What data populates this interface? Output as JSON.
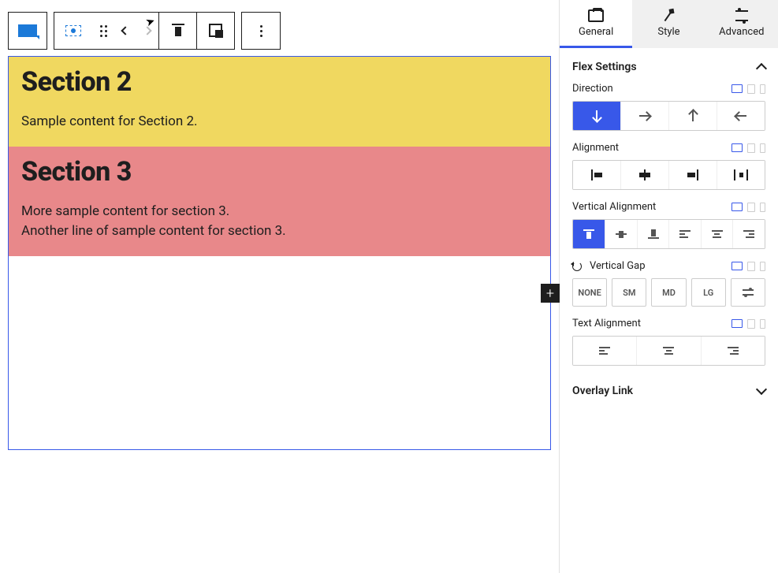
{
  "toolbar": {
    "block_type": "stack-block",
    "select_parent": "select-parent",
    "drag": "drag-handle",
    "move_prev": "move-left",
    "move_next": "move-right",
    "align": "align-top",
    "overlap": "overlap-toggle",
    "more": "more-options"
  },
  "content": {
    "sections": [
      {
        "heading": "Section 2",
        "paragraphs": [
          "Sample content for Section 2."
        ],
        "bg": "yellow"
      },
      {
        "heading": "Section 3",
        "paragraphs": [
          "More sample content for section 3.",
          "Another line of sample content for section 3."
        ],
        "bg": "pink"
      }
    ],
    "add_label": "+"
  },
  "sidebar": {
    "tabs": [
      {
        "label": "General",
        "active": true
      },
      {
        "label": "Style",
        "active": false
      },
      {
        "label": "Advanced",
        "active": false
      }
    ],
    "panels": {
      "flex": {
        "title": "Flex Settings",
        "controls": {
          "direction": {
            "label": "Direction",
            "options": [
              "down",
              "right",
              "up",
              "left"
            ],
            "active": 0
          },
          "alignment": {
            "label": "Alignment",
            "options": [
              "start",
              "center",
              "end",
              "space-between"
            ],
            "active": null
          },
          "vertical_alignment": {
            "label": "Vertical Alignment",
            "options": [
              "top",
              "middle",
              "bottom",
              "stretch-left",
              "stretch-center",
              "stretch-right"
            ],
            "active": 0
          },
          "vertical_gap": {
            "label": "Vertical Gap",
            "options": [
              "NONE",
              "SM",
              "MD",
              "LG"
            ],
            "custom": true,
            "active": null
          },
          "text_alignment": {
            "label": "Text Alignment",
            "options": [
              "left",
              "center",
              "right"
            ],
            "active": null
          }
        }
      },
      "overlay": {
        "title": "Overlay Link"
      }
    }
  }
}
